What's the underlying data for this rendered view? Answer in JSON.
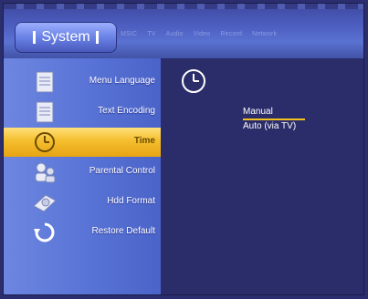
{
  "header": {
    "title": "System",
    "tabs": [
      "MSIC",
      "TV",
      "Audio",
      "Video",
      "Record",
      "Network"
    ]
  },
  "sidebar": {
    "items": [
      {
        "label": "Menu Language",
        "icon": "document-icon",
        "selected": false
      },
      {
        "label": "Text Encoding",
        "icon": "document-icon",
        "selected": false
      },
      {
        "label": "Time",
        "icon": "clock-icon",
        "selected": true
      },
      {
        "label": "Parental Control",
        "icon": "parental-icon",
        "selected": false
      },
      {
        "label": "Hdd Format",
        "icon": "hdd-icon",
        "selected": false
      },
      {
        "label": "Restore Default",
        "icon": "restore-icon",
        "selected": false
      }
    ]
  },
  "content": {
    "icon": "clock-icon",
    "options": [
      {
        "label": "Manual",
        "selected": true
      },
      {
        "label": "Auto (via TV)",
        "selected": false
      }
    ]
  },
  "colors": {
    "background": "#2b2c6a",
    "sidebar": "#5873d6",
    "highlight": "#f4be2e"
  }
}
